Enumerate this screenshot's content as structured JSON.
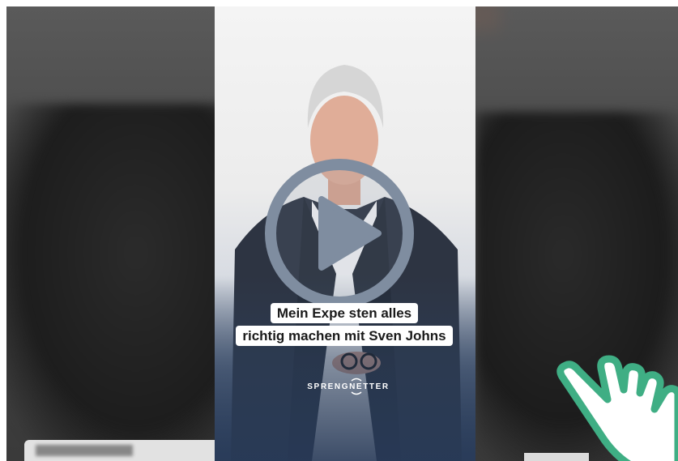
{
  "video": {
    "caption_line1": "Mein Expe        sten alles",
    "caption_line2": "richtig machen mit Sven Johns",
    "brand": "SPRENGNETTER"
  },
  "icons": {
    "play": "play-icon",
    "cursor": "pointing-hand-icon",
    "brand_mark": "sprengnetter-mark-icon"
  },
  "colors": {
    "play_ring": "#7f8da0",
    "hand_outline": "#3fae84",
    "caption_bg": "#ffffff",
    "video_bottom": "#354863"
  }
}
